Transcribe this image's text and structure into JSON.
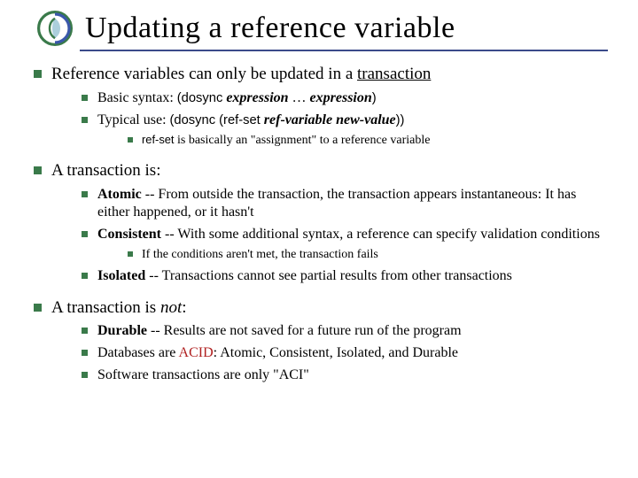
{
  "title": "Updating a reference variable",
  "top1_pre": "Reference variables can only be updated in a ",
  "top1_u": "transaction",
  "syn_pre": "Basic syntax: ",
  "syn_open": "(dosync",
  "syn_e1": " expression",
  "syn_dots": " … ",
  "syn_e2": "expression",
  "syn_close": ")",
  "typ_pre": "Typical use: ",
  "typ_open": "(dosync (ref-set",
  "typ_rv": " ref-variable",
  "typ_sp": "  ",
  "typ_nv": "new-value",
  "typ_close": "))",
  "rs1": "ref-set",
  "rs2": " is basically an \"assignment\" to a reference variable",
  "trans_is": "A transaction is:",
  "atomic_b": "Atomic",
  "atomic_t": " -- From outside the transaction, the transaction appears instantaneous: It has either happened, or it hasn't",
  "cons_b": "Consistent",
  "cons_t": " -- With some additional syntax, a reference can specify validation conditions",
  "cond_t": "If the conditions aren't met, the transaction fails",
  "iso_b": "Isolated",
  "iso_t": " -- Transactions cannot see partial results from other transactions",
  "not_pre": "A transaction is ",
  "not_i": "not",
  "not_post": ":",
  "dur_b": "Durable",
  "dur_t": " -- Results are not saved for a future run of the program",
  "db_pre": "Databases are ",
  "db_acid": "ACID",
  "db_post": ": Atomic, Consistent, Isolated, and Durable",
  "aci": "Software transactions are only \"ACI\""
}
